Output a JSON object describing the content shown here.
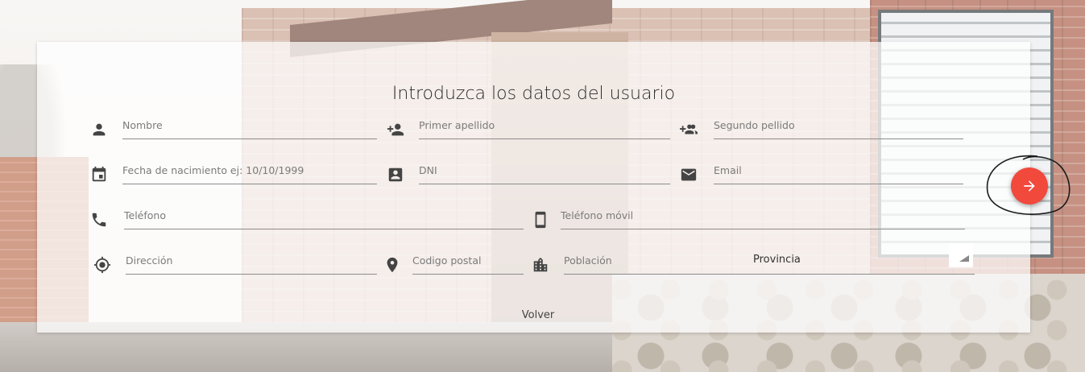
{
  "form": {
    "title": "Introduzca los datos del usuario",
    "fields": {
      "nombre": "Nombre",
      "primer_apellido": "Primer apellido",
      "segundo_apellido": "Segundo pellido",
      "fecha_nacimiento": "Fecha de nacimiento ej: 10/10/1999",
      "dni": "DNI",
      "email": "Email",
      "telefono": "Teléfono",
      "telefono_movil": "Teléfono móvil",
      "direccion": "Dirección",
      "codigo_postal": "Codigo postal",
      "poblacion": "Población"
    },
    "provincia": {
      "label": "Provincia",
      "value": ""
    },
    "back_label": "Volver"
  },
  "icons": {
    "nombre": "person-icon",
    "primer_apellido": "person-add-icon",
    "segundo_apellido": "group-add-icon",
    "fecha_nacimiento": "calendar-icon",
    "dni": "id-card-icon",
    "email": "mail-icon",
    "telefono": "phone-icon",
    "telefono_movil": "smartphone-icon",
    "direccion": "gps-target-icon",
    "codigo_postal": "location-pin-icon",
    "poblacion": "city-icon",
    "next": "arrow-right-icon"
  },
  "colors": {
    "accent": "#f1493c",
    "text": "#2b2b2b",
    "placeholder": "#7b7b7b"
  }
}
